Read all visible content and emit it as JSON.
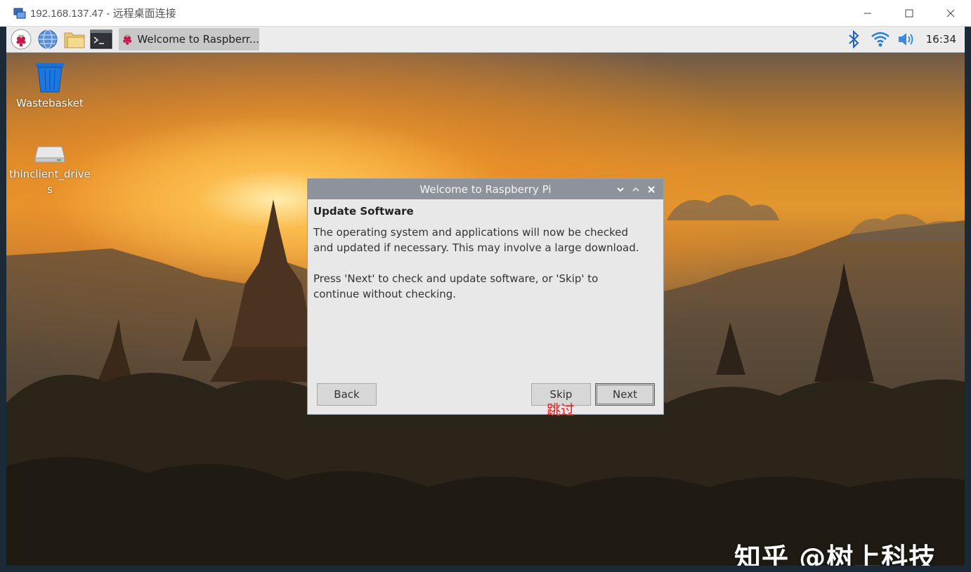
{
  "rdp": {
    "title": "192.168.137.47 - 远程桌面连接",
    "icon": "remote-desktop-icon",
    "controls": [
      "minimize",
      "maximize",
      "close"
    ]
  },
  "panel": {
    "launchers": [
      "raspberry-menu-icon",
      "web-browser-icon",
      "file-manager-icon",
      "terminal-icon"
    ],
    "task": {
      "icon": "raspberry-icon",
      "label": "Welcome to Raspberr..."
    },
    "tray": {
      "icons": [
        "bluetooth-icon",
        "wifi-icon",
        "volume-icon"
      ],
      "clock": "16:34"
    }
  },
  "desktop": {
    "icons": [
      {
        "name": "trash-icon",
        "label": "Wastebasket"
      },
      {
        "name": "drive-icon",
        "label": "thinclient_drives"
      }
    ]
  },
  "dialog": {
    "title": "Welcome to Raspberry Pi",
    "heading": "Update Software",
    "paragraph1": "The operating system and applications will now be checked and updated if necessary. This may involve a large download.",
    "paragraph2": "Press 'Next' to check and update software, or 'Skip' to continue without checking.",
    "back_label": "Back",
    "skip_label": "Skip",
    "next_label": "Next"
  },
  "annotation": "跳过",
  "watermark": "知乎 @树上科技",
  "colors": {
    "dialog_title_bg": "#8e939b",
    "annotation": "#e02020",
    "panel_bg": "#ececec"
  }
}
